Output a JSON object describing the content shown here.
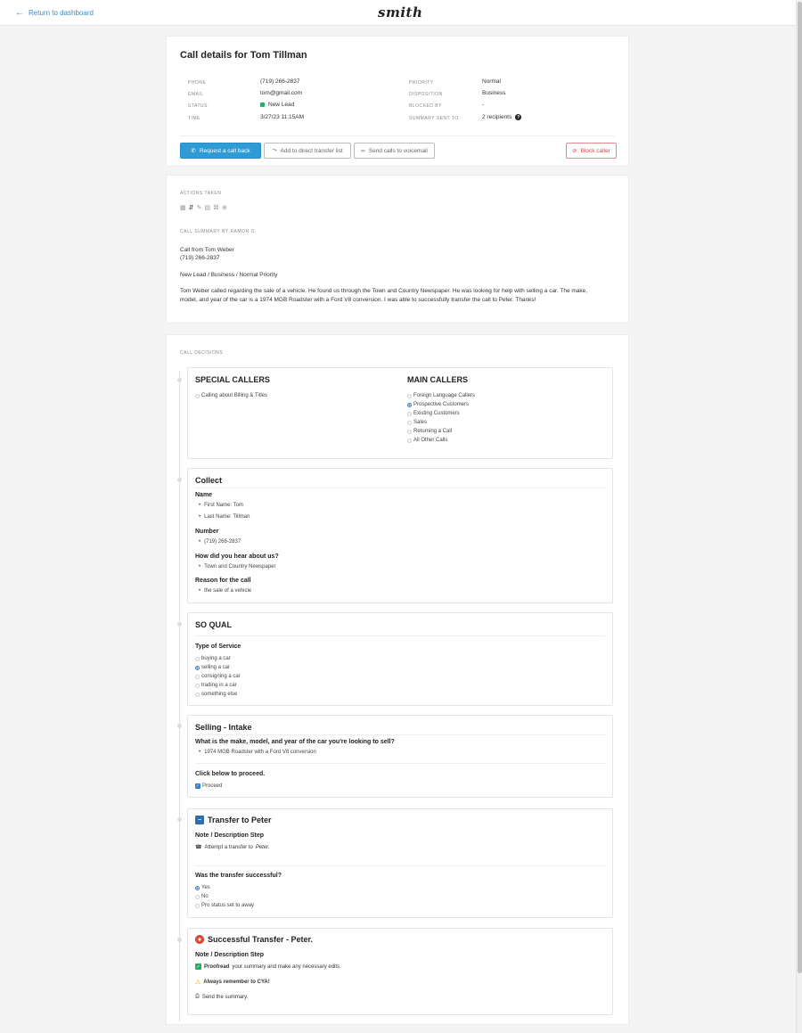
{
  "topbar": {
    "back_label": "Return to dashboard",
    "logo": "smith"
  },
  "details": {
    "title": "Call details for Tom Tillman",
    "left": [
      {
        "label": "PHONE",
        "value": "(719) 266-2837"
      },
      {
        "label": "EMAIL",
        "value": "tom@gmail.com"
      },
      {
        "label": "STATUS",
        "value": "New Lead"
      },
      {
        "label": "TIME",
        "value": "3/27/23 11:15AM"
      }
    ],
    "right": [
      {
        "label": "PRIORITY",
        "value": "Normal"
      },
      {
        "label": "DISPOSITION",
        "value": "Business"
      },
      {
        "label": "BLOCKED BY",
        "value": "-"
      },
      {
        "label": "SUMMARY SENT TO",
        "value": "2 recipients"
      }
    ],
    "status_color": "#27ae60",
    "buttons": {
      "callback": "Request a call back",
      "direct_transfer": "Add to direct transfer list",
      "voicemail": "Send calls to voicemail",
      "block": "Block caller"
    }
  },
  "summary": {
    "actions_label": "ACTIONS TAKEN",
    "summary_label": "CALL SUMMARY BY RAMON O.",
    "line1": "Call from Tom Weber",
    "line2": "(719) 266-2837",
    "line3": "New Lead / Business / Normal Priority",
    "paragraph": "Tom Weber called regarding the sale of a vehicle. He found us through the Town and Country Newspaper. He was looking for help with selling a car. The make, model, and year of the car is a 1974 MGB Roadster with a Ford V8 conversion. I was able to successfully transfer the call to Peter. Thanks!"
  },
  "decisions": {
    "label": "CALL DECISIONS",
    "callers": {
      "special_title": "SPECIAL CALLERS",
      "special_options": [
        "Calling about Billing & Titles"
      ],
      "main_title": "MAIN CALLERS",
      "main_options": [
        "Foreign Language Callers",
        "Prospective Customers",
        "Existing Customers",
        "Sales",
        "Returning a Call",
        "All Other Calls"
      ],
      "main_selected": "Prospective Customers"
    },
    "collect": {
      "title": "Collect",
      "name_label": "Name",
      "first_name": "First Name: Tom",
      "last_name": "Last Name: Tillman",
      "number_label": "Number",
      "number": "(719) 266-2837",
      "hear_label": "How did you hear about us?",
      "hear": "Town and Country Newspaper",
      "reason_label": "Reason for the call",
      "reason": "the sale of a vehicle"
    },
    "soqual": {
      "title": "SO QUAL",
      "type_label": "Type of Service",
      "options": [
        "buying a car",
        "selling a car",
        "consigning a car",
        "trading in a car",
        "something else"
      ],
      "selected": "selling a car"
    },
    "intake": {
      "title": "Selling - Intake",
      "question": "What is the make, model, and year of the car you're looking to sell?",
      "answer": "1974 MGB Roadster with a Ford V8 conversion",
      "proceed_label": "Click below to proceed.",
      "proceed_option": "Proceed"
    },
    "transfer": {
      "title": "Transfer to Peter",
      "note_label": "Note / Description Step",
      "note_prefix": "Attempt a transfer to",
      "note_name": "Peter.",
      "question": "Was the transfer successful?",
      "options": [
        "Yes",
        "No",
        "Pro status set to away"
      ],
      "selected": "Yes"
    },
    "success": {
      "title": "Successful Transfer - Peter.",
      "note_label": "Note / Description Step",
      "proofread_bold": "Proofread",
      "proofread_rest": "your summary and make any necessary edits.",
      "cya": "Always remember to CYA!",
      "send": "Send the summary."
    }
  }
}
